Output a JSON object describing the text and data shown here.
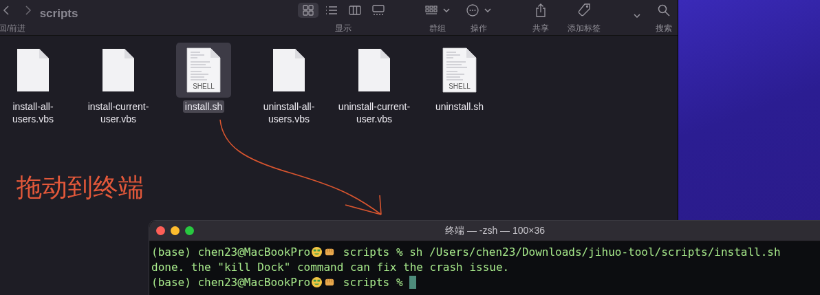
{
  "finder": {
    "nav_label": "回/前进",
    "folder_title": "scripts",
    "toolbar": [
      {
        "kind": "views",
        "label": "显示",
        "views": [
          {
            "kind": "grid",
            "selected": true
          },
          {
            "kind": "list",
            "selected": false
          },
          {
            "kind": "columns",
            "selected": false
          },
          {
            "kind": "gallery",
            "selected": false
          }
        ]
      },
      {
        "kind": "group",
        "label": "群组"
      },
      {
        "kind": "action",
        "label": "操作"
      },
      {
        "kind": "share",
        "label": "共享"
      },
      {
        "kind": "tag",
        "label": "添加标签"
      },
      {
        "kind": "more"
      },
      {
        "kind": "search",
        "label": "搜索"
      }
    ],
    "files": [
      {
        "name": "install-all-users.vbs",
        "kind": "blank",
        "selected": false
      },
      {
        "name": "install-current-user.vbs",
        "kind": "blank",
        "selected": false
      },
      {
        "name": "install.sh",
        "kind": "shell",
        "selected": true
      },
      {
        "name": "uninstall-all-users.vbs",
        "kind": "blank",
        "selected": false
      },
      {
        "name": "uninstall-current-user.vbs",
        "kind": "blank",
        "selected": false
      },
      {
        "name": "uninstall.sh",
        "kind": "shell",
        "selected": false
      }
    ],
    "shell_badge": [
      "SHELL",
      "SHELL"
    ]
  },
  "annotation": {
    "text": "拖动到终端"
  },
  "terminal": {
    "title": "终端 — -zsh — 100×36",
    "lines": [
      {
        "kind": "prompt",
        "user": "(base) chen23@MacBookPro",
        "cwd": "scripts %",
        "command": "sh /Users/chen23/Downloads/jihuo-tool/scripts/install.sh"
      },
      {
        "kind": "output",
        "text": "done. the \"kill Dock\" command can fix the crash issue."
      },
      {
        "kind": "prompt",
        "user": "(base) chen23@MacBookPro",
        "cwd": "scripts %",
        "cursor": true
      }
    ]
  }
}
